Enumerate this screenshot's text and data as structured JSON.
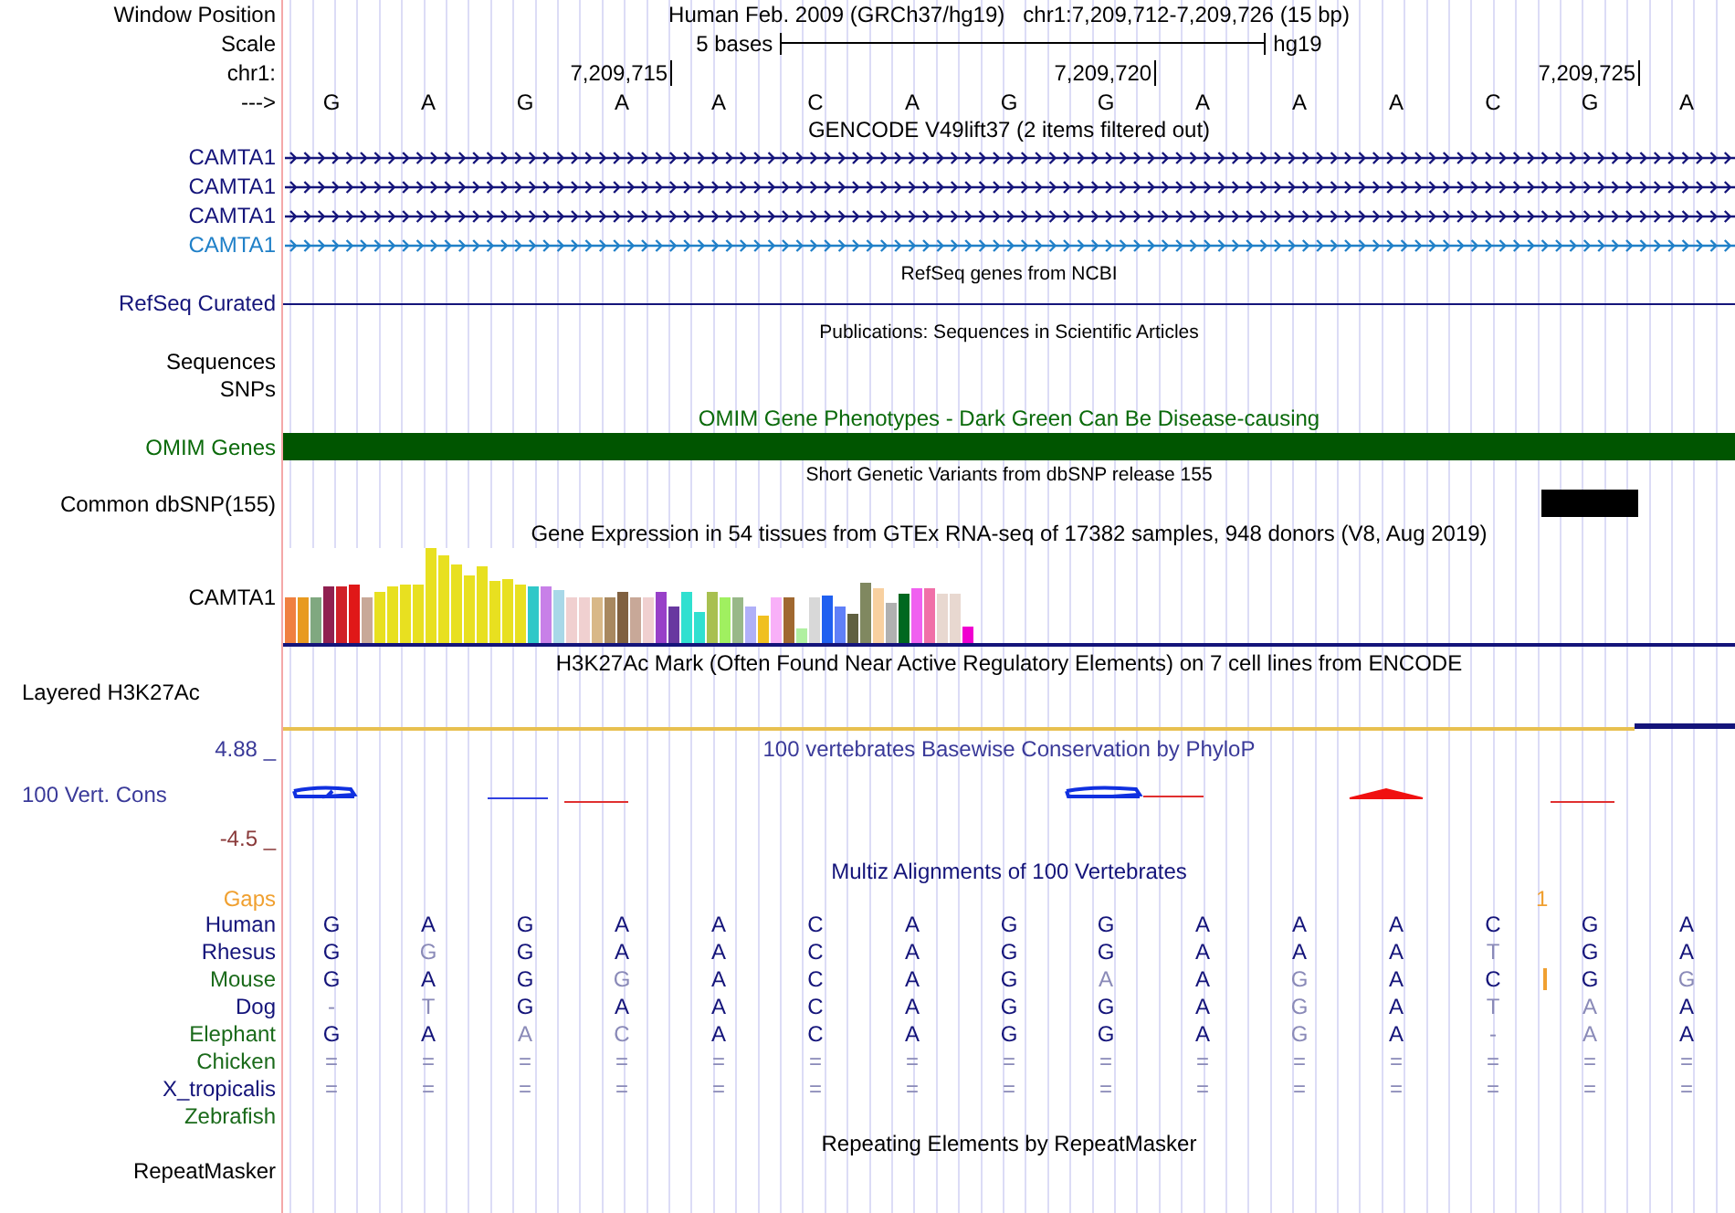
{
  "position_bar": {
    "label": "Window Position",
    "assembly": "Human Feb. 2009 (GRCh37/hg19)",
    "range": "chr1:7,209,712-7,209,726 (15 bp)"
  },
  "scale": {
    "label": "Scale",
    "length": "5 bases",
    "assembly": "hg19"
  },
  "ruler": {
    "label": "chr1:",
    "ticks": [
      "7,209,715",
      "7,209,720",
      "7,209,725"
    ]
  },
  "sequence": {
    "label": "--->",
    "bases": [
      "G",
      "A",
      "G",
      "A",
      "A",
      "C",
      "A",
      "G",
      "G",
      "A",
      "A",
      "A",
      "C",
      "G",
      "A"
    ]
  },
  "gencode": {
    "title": "GENCODE V49lift37 (2 items filtered out)",
    "transcripts": [
      {
        "name": "CAMTA1",
        "color": "#14147a"
      },
      {
        "name": "CAMTA1",
        "color": "#14147a"
      },
      {
        "name": "CAMTA1",
        "color": "#14147a"
      },
      {
        "name": "CAMTA1",
        "color": "#2080c8"
      }
    ]
  },
  "refseq": {
    "title": "RefSeq genes from NCBI",
    "label": "RefSeq Curated"
  },
  "publications": {
    "title": "Publications: Sequences in Scientific Articles",
    "labels": [
      "Sequences",
      "SNPs"
    ]
  },
  "omim": {
    "title": "OMIM Gene Phenotypes - Dark Green Can Be Disease-causing",
    "label": "OMIM Genes"
  },
  "dbsnp": {
    "title": "Short Genetic Variants from dbSNP release 155",
    "label": "Common dbSNP(155)"
  },
  "gtex": {
    "title": "Gene Expression in 54 tissues from GTEx RNA-seq of 17382 samples, 948 donors (V8, Aug 2019)",
    "label": "CAMTA1"
  },
  "h3k27ac": {
    "title": "H3K27Ac Mark (Often Found Near Active Regulatory Elements) on 7 cell lines from ENCODE",
    "label": "Layered H3K27Ac"
  },
  "conservation": {
    "title": "100 vertebrates Basewise Conservation by PhyloP",
    "label": "100 Vert. Cons",
    "max": "4.88 _",
    "min": "-4.5 _"
  },
  "multiz": {
    "title": "Multiz Alignments of 100 Vertebrates",
    "gaps": {
      "label": "Gaps",
      "count": "1"
    },
    "species": [
      {
        "name": "Human",
        "color": "#14147a",
        "insertion": false,
        "bases": [
          {
            "base": "G",
            "faded": false
          },
          {
            "base": "A",
            "faded": false
          },
          {
            "base": "G",
            "faded": false
          },
          {
            "base": "A",
            "faded": false
          },
          {
            "base": "A",
            "faded": false
          },
          {
            "base": "C",
            "faded": false
          },
          {
            "base": "A",
            "faded": false
          },
          {
            "base": "G",
            "faded": false
          },
          {
            "base": "G",
            "faded": false
          },
          {
            "base": "A",
            "faded": false
          },
          {
            "base": "A",
            "faded": false
          },
          {
            "base": "A",
            "faded": false
          },
          {
            "base": "C",
            "faded": false
          },
          {
            "base": "G",
            "faded": false
          },
          {
            "base": "A",
            "faded": false
          }
        ]
      },
      {
        "name": "Rhesus",
        "color": "#14147a",
        "insertion": false,
        "bases": [
          {
            "base": "G",
            "faded": false
          },
          {
            "base": "G",
            "faded": true
          },
          {
            "base": "G",
            "faded": false
          },
          {
            "base": "A",
            "faded": false
          },
          {
            "base": "A",
            "faded": false
          },
          {
            "base": "C",
            "faded": false
          },
          {
            "base": "A",
            "faded": false
          },
          {
            "base": "G",
            "faded": false
          },
          {
            "base": "G",
            "faded": false
          },
          {
            "base": "A",
            "faded": false
          },
          {
            "base": "A",
            "faded": false
          },
          {
            "base": "A",
            "faded": false
          },
          {
            "base": "T",
            "faded": true
          },
          {
            "base": "G",
            "faded": false
          },
          {
            "base": "A",
            "faded": false
          }
        ]
      },
      {
        "name": "Mouse",
        "color": "#1a6a1a",
        "insertion": true,
        "bases": [
          {
            "base": "G",
            "faded": false
          },
          {
            "base": "A",
            "faded": false
          },
          {
            "base": "G",
            "faded": false
          },
          {
            "base": "G",
            "faded": true
          },
          {
            "base": "A",
            "faded": false
          },
          {
            "base": "C",
            "faded": false
          },
          {
            "base": "A",
            "faded": false
          },
          {
            "base": "G",
            "faded": false
          },
          {
            "base": "A",
            "faded": true
          },
          {
            "base": "A",
            "faded": false
          },
          {
            "base": "G",
            "faded": true
          },
          {
            "base": "A",
            "faded": false
          },
          {
            "base": "C",
            "faded": false
          },
          {
            "base": "G",
            "faded": false
          },
          {
            "base": "G",
            "faded": true
          }
        ]
      },
      {
        "name": "Dog",
        "color": "#14147a",
        "insertion": false,
        "bases": [
          {
            "base": "-",
            "faded": true
          },
          {
            "base": "T",
            "faded": true
          },
          {
            "base": "G",
            "faded": false
          },
          {
            "base": "A",
            "faded": false
          },
          {
            "base": "A",
            "faded": false
          },
          {
            "base": "C",
            "faded": false
          },
          {
            "base": "A",
            "faded": false
          },
          {
            "base": "G",
            "faded": false
          },
          {
            "base": "G",
            "faded": false
          },
          {
            "base": "A",
            "faded": false
          },
          {
            "base": "G",
            "faded": true
          },
          {
            "base": "A",
            "faded": false
          },
          {
            "base": "T",
            "faded": true
          },
          {
            "base": "A",
            "faded": true
          },
          {
            "base": "A",
            "faded": false
          }
        ]
      },
      {
        "name": "Elephant",
        "color": "#1a6a1a",
        "insertion": false,
        "bases": [
          {
            "base": "G",
            "faded": false
          },
          {
            "base": "A",
            "faded": false
          },
          {
            "base": "A",
            "faded": true
          },
          {
            "base": "C",
            "faded": true
          },
          {
            "base": "A",
            "faded": false
          },
          {
            "base": "C",
            "faded": false
          },
          {
            "base": "A",
            "faded": false
          },
          {
            "base": "G",
            "faded": false
          },
          {
            "base": "G",
            "faded": false
          },
          {
            "base": "A",
            "faded": false
          },
          {
            "base": "G",
            "faded": true
          },
          {
            "base": "A",
            "faded": false
          },
          {
            "base": "-",
            "faded": true
          },
          {
            "base": "A",
            "faded": true
          },
          {
            "base": "A",
            "faded": false
          }
        ]
      },
      {
        "name": "Chicken",
        "color": "#1a6a1a",
        "insertion": false,
        "bases": [
          {
            "base": "=",
            "faded": true
          },
          {
            "base": "=",
            "faded": true
          },
          {
            "base": "=",
            "faded": true
          },
          {
            "base": "=",
            "faded": true
          },
          {
            "base": "=",
            "faded": true
          },
          {
            "base": "=",
            "faded": true
          },
          {
            "base": "=",
            "faded": true
          },
          {
            "base": "=",
            "faded": true
          },
          {
            "base": "=",
            "faded": true
          },
          {
            "base": "=",
            "faded": true
          },
          {
            "base": "=",
            "faded": true
          },
          {
            "base": "=",
            "faded": true
          },
          {
            "base": "=",
            "faded": true
          },
          {
            "base": "=",
            "faded": true
          },
          {
            "base": "=",
            "faded": true
          }
        ]
      },
      {
        "name": "X_tropicalis",
        "color": "#14147a",
        "insertion": false,
        "bases": [
          {
            "base": "=",
            "faded": true
          },
          {
            "base": "=",
            "faded": true
          },
          {
            "base": "=",
            "faded": true
          },
          {
            "base": "=",
            "faded": true
          },
          {
            "base": "=",
            "faded": true
          },
          {
            "base": "=",
            "faded": true
          },
          {
            "base": "=",
            "faded": true
          },
          {
            "base": "=",
            "faded": true
          },
          {
            "base": "=",
            "faded": true
          },
          {
            "base": "=",
            "faded": true
          },
          {
            "base": "=",
            "faded": true
          },
          {
            "base": "=",
            "faded": true
          },
          {
            "base": "=",
            "faded": true
          },
          {
            "base": "=",
            "faded": true
          },
          {
            "base": "=",
            "faded": true
          }
        ]
      },
      {
        "name": "Zebrafish",
        "color": "#1a6a1a",
        "insertion": false
      }
    ]
  },
  "repeatmasker": {
    "title": "Repeating Elements by RepeatMasker",
    "label": "RepeatMasker"
  }
}
